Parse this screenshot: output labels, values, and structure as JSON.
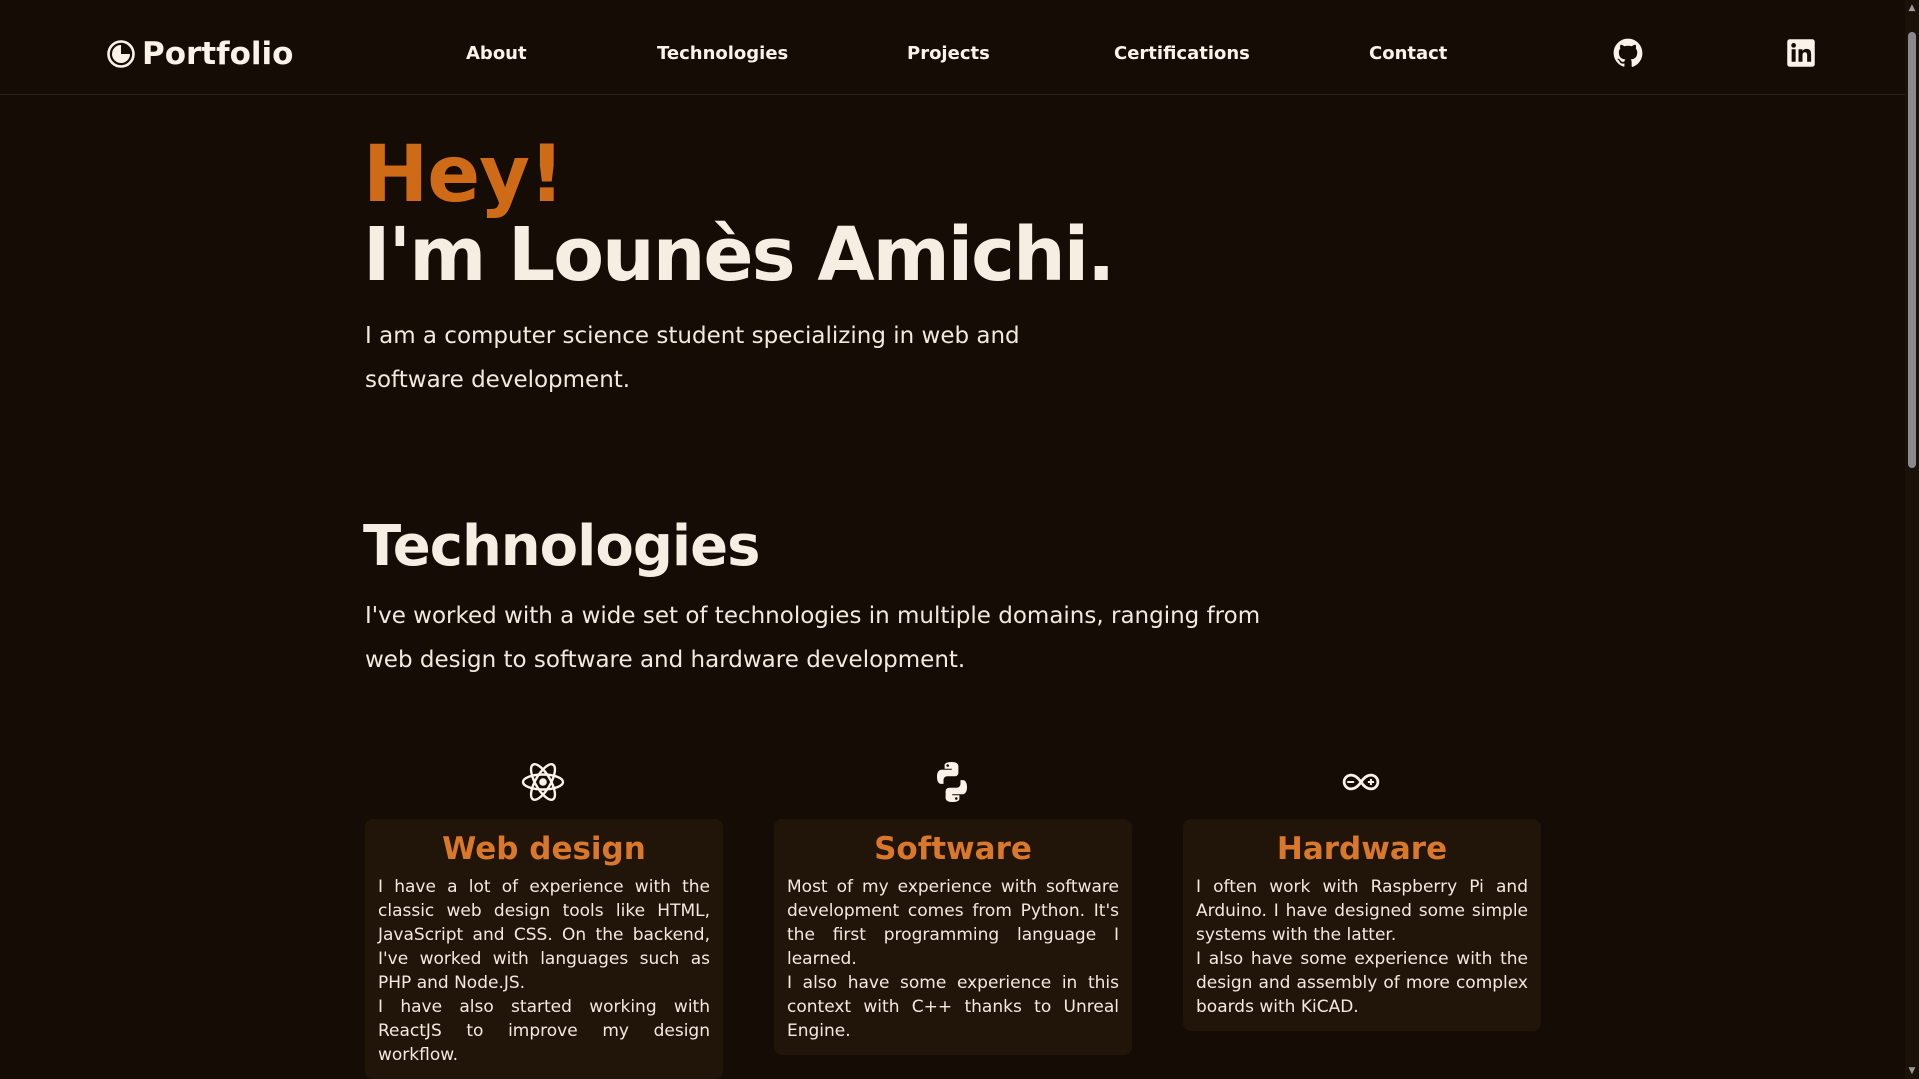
{
  "nav": {
    "brand": "Portfolio",
    "links": [
      "About",
      "Technologies",
      "Projects",
      "Certifications",
      "Contact"
    ],
    "social": [
      "github-icon",
      "linkedin-icon"
    ]
  },
  "hero": {
    "greeting": "Hey!",
    "name": "I'm Lounès Amichi.",
    "description": "I am a computer science student specializing in web and software development."
  },
  "technologies": {
    "title": "Technologies",
    "description": "I've worked with a wide set of technologies in multiple domains, ranging from web design to software and hardware development.",
    "cards": [
      {
        "icon": "react-icon",
        "title": "Web design",
        "paragraphs": [
          "I have a lot of experience with the classic web design tools like HTML, JavaScript and CSS. On the backend, I've worked with languages such as PHP and Node.JS.",
          "I have also started working with ReactJS to improve my design workflow."
        ]
      },
      {
        "icon": "python-icon",
        "title": "Software",
        "paragraphs": [
          "Most of my experience with software development comes from Python. It's the first programming language I learned.",
          "I also have some experience in this context with C++ thanks to Unreal Engine."
        ]
      },
      {
        "icon": "arduino-icon",
        "title": "Hardware",
        "paragraphs": [
          "I often work with Raspberry Pi and Arduino. I have designed some simple systems with the latter.",
          "I also have some experience with the design and assembly of more complex boards with KiCAD."
        ]
      }
    ]
  },
  "colors": {
    "background": "#140c05",
    "accent": "#cf6a17",
    "card_title": "#d9782a",
    "card_bg": "#21150a",
    "text": "#f6ede3"
  }
}
